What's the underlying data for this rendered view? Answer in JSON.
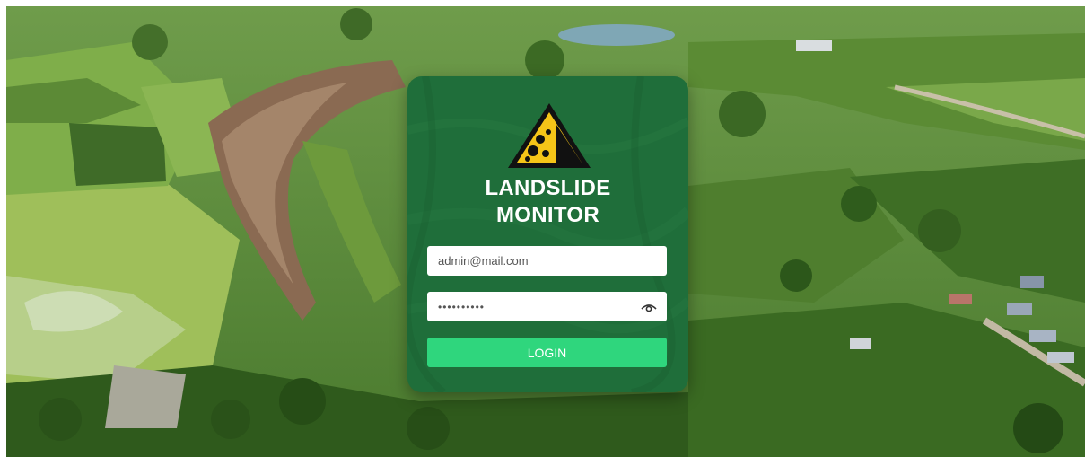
{
  "brand": {
    "title_line1": "LANDSLIDE",
    "title_line2": "MONITOR",
    "logo_icon": "landslide-warning-icon"
  },
  "form": {
    "email_value": "admin@mail.com",
    "password_value": "••••••••••",
    "show_password_icon": "eye-icon",
    "login_label": "LOGIN"
  },
  "colors": {
    "card": "#1f6e3a",
    "button": "#2fd67d",
    "warning_yellow": "#f5c518"
  }
}
